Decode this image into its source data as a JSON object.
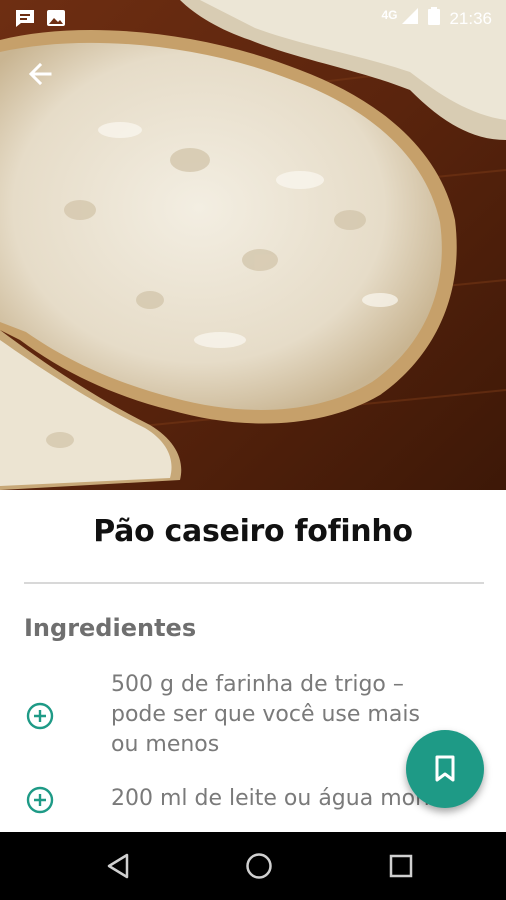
{
  "statusbar": {
    "network": "4G",
    "time": "21:36",
    "icons": [
      "chat-notification-icon",
      "image-notification-icon",
      "signal-icon",
      "battery-icon"
    ]
  },
  "recipe": {
    "title": "Pão caseiro fofinho",
    "section_title": "Ingredientes",
    "ingredients": [
      {
        "line1": "500 g de farinha de trigo –",
        "line2": "pode ser que você use mais",
        "line3": "ou menos"
      },
      {
        "line1": "200 ml de leite ou água morna",
        "line2": "",
        "line3": ""
      }
    ]
  },
  "colors": {
    "accent": "#1e9a86",
    "title": "#111111",
    "section": "#6f6f6f",
    "text": "#7a7a7a"
  },
  "icons": {
    "back": "arrow-left-icon",
    "add": "plus-circle-icon",
    "fab": "bookmark-icon",
    "nav_back": "triangle-back-icon",
    "nav_home": "circle-home-icon",
    "nav_recents": "square-recents-icon"
  }
}
